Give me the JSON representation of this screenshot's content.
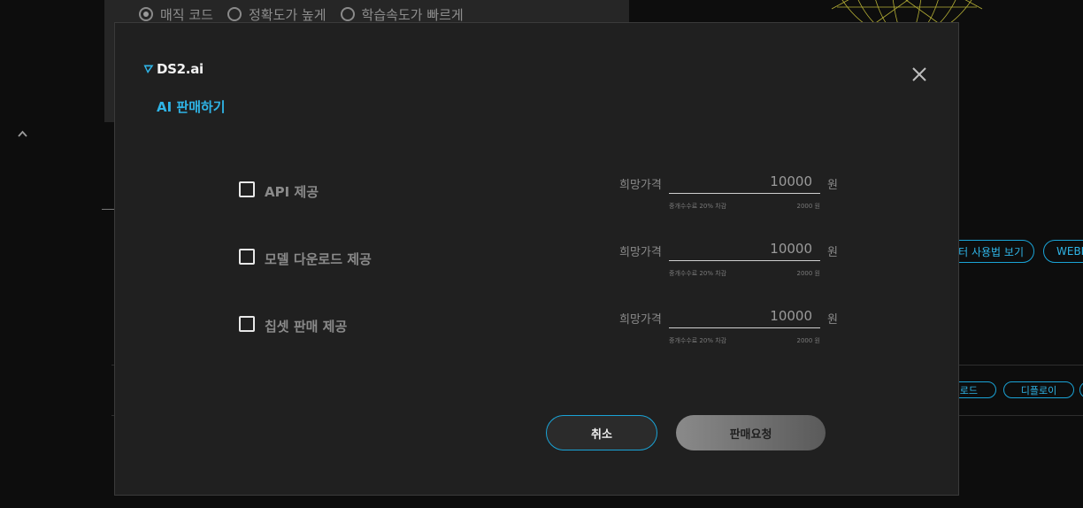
{
  "background": {
    "radio_options": [
      {
        "label": "매직 코드",
        "selected": true
      },
      {
        "label": "정확도가 높게",
        "selected": false
      },
      {
        "label": "학습속도가 빠르게",
        "selected": false
      }
    ],
    "pills": [
      "터 사용법 보기",
      "WEBH",
      "로드",
      "디플로이"
    ]
  },
  "modal": {
    "logo_text": "DS2.ai",
    "title": "AI 판매하기",
    "options": [
      {
        "label": "API 제공",
        "price_label": "희망가격",
        "price_value": "10000",
        "unit": "원",
        "fee_note": "중개수수료 20% 차감",
        "fee_amount": "2000 원",
        "checked": false
      },
      {
        "label": "모델 다운로드 제공",
        "price_label": "희망가격",
        "price_value": "10000",
        "unit": "원",
        "fee_note": "중개수수료 20% 차감",
        "fee_amount": "2000 원",
        "checked": false
      },
      {
        "label": "칩셋 판매 제공",
        "price_label": "희망가격",
        "price_value": "10000",
        "unit": "원",
        "fee_note": "중개수수료 20% 차감",
        "fee_amount": "2000 원",
        "checked": false
      }
    ],
    "cancel_label": "취소",
    "submit_label": "판매요청"
  },
  "colors": {
    "accent": "#2fb4e6",
    "modal_bg": "#202020",
    "page_bg": "#0d0d0d",
    "globe": "#c9c23a"
  },
  "icons": [
    "ds2-logo-icon",
    "close-icon",
    "chevron-up-icon",
    "checkbox-icon",
    "radio-icon"
  ]
}
